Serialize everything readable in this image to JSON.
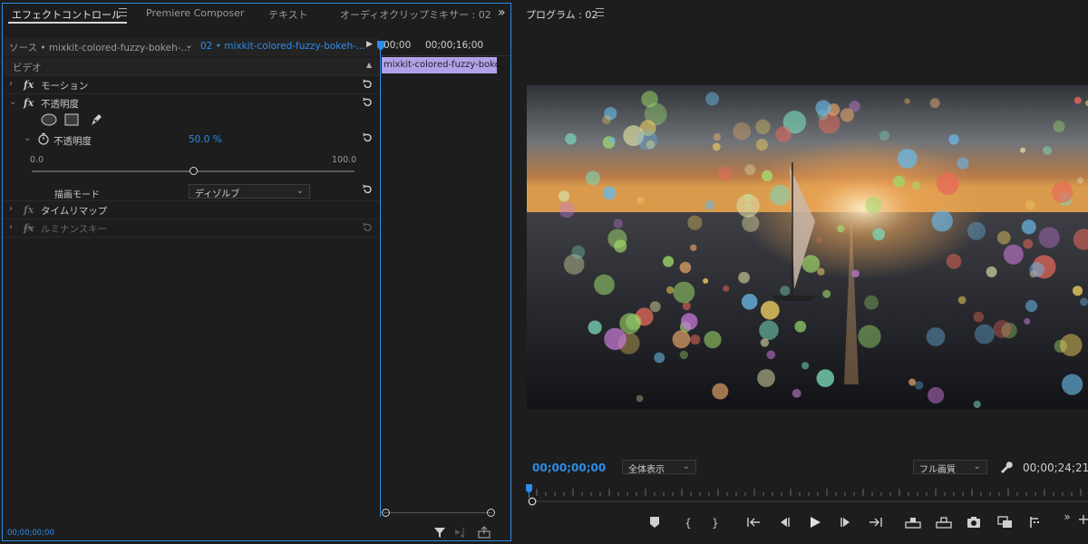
{
  "left_panel": {
    "tabs": [
      {
        "label": "エフェクトコントロール",
        "active": true
      },
      {
        "label": "Premiere Composer",
        "active": false
      },
      {
        "label": "テキスト",
        "active": false
      },
      {
        "label": "オーディオクリップミキサー : 02",
        "active": false
      }
    ],
    "overflow_glyph": "»",
    "source_tab": "ソース • mixkit-colored-fuzzy-bokeh-...",
    "sequence_tab": "02 • mixkit-colored-fuzzy-bokeh-...",
    "timecode_start": "00;00",
    "timecode_end": "00;00;16;00",
    "clip_name": "mixkit-colored-fuzzy-boke",
    "section_video": "ビデオ",
    "effects": {
      "motion": "モーション",
      "opacity": "不透明度",
      "opacity_property": "不透明度",
      "opacity_value": "50.0 %",
      "slider_min": "0.0",
      "slider_max": "100.0",
      "slider_fraction": 0.5,
      "blend_mode_label": "描画モード",
      "blend_mode_value": "ディゾルブ",
      "time_remap": "タイムリマップ",
      "luma_key": "ルミナンスキー"
    },
    "footer_timecode": "00;00;00;00"
  },
  "right_panel": {
    "title": "プログラム : 02",
    "current_timecode": "00;00;00;00",
    "zoom_value": "全体表示",
    "quality_value": "フル画質",
    "duration_timecode": "00;00;24;21"
  },
  "colors": {
    "accent": "#2d8ceb",
    "clip": "#b2a1e8",
    "panel_bg": "#1d1d1d"
  }
}
